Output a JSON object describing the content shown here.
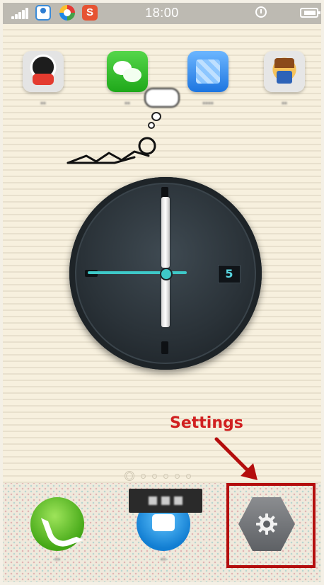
{
  "status_bar": {
    "time": "18:00",
    "left_icons": [
      "signal-icon",
      "qq-status-icon",
      "browser-status-icon",
      "sogou-status-icon"
    ],
    "sogou_glyph": "S",
    "right_icons": [
      "alarm-icon",
      "battery-icon"
    ]
  },
  "home_apps": [
    {
      "name": "qq",
      "icon": "qq-penguin-icon"
    },
    {
      "name": "wechat",
      "icon": "wechat-icon"
    },
    {
      "name": "app-store",
      "icon": "app-store-icon"
    },
    {
      "name": "game",
      "icon": "game-icon"
    }
  ],
  "clock_widget": {
    "date": "5",
    "accent_color": "#3ec8c8"
  },
  "annotation": {
    "label": "Settings",
    "color": "#d12020"
  },
  "pager": {
    "pages": 6,
    "active_index": 0
  },
  "dock": [
    {
      "name": "phone",
      "icon": "phone-icon"
    },
    {
      "name": "messages",
      "icon": "message-icon"
    },
    {
      "name": "settings",
      "icon": "gear-icon"
    }
  ]
}
